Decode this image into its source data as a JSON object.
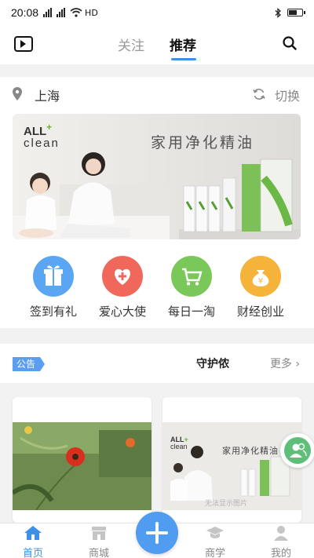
{
  "status_bar": {
    "time": "20:08",
    "network": "HD",
    "battery_level": 0.6
  },
  "top_nav": {
    "tabs": [
      {
        "label": "关注",
        "active": false
      },
      {
        "label": "推荐",
        "active": true
      }
    ]
  },
  "location": {
    "city": "上海",
    "switch_label": "切换"
  },
  "banner": {
    "title": "家用净化精油",
    "brand_line1": "ALL",
    "brand_line2": "clean"
  },
  "quick_actions": [
    {
      "label": "签到有礼",
      "icon": "gift-icon",
      "color": "#5aa6f2"
    },
    {
      "label": "爱心大使",
      "icon": "heart-plus-icon",
      "color": "#f0685c"
    },
    {
      "label": "每日一淘",
      "icon": "cart-icon",
      "color": "#7ac85a"
    },
    {
      "label": "财经创业",
      "icon": "money-bag-icon",
      "color": "#f5b33a"
    }
  ],
  "notice": {
    "badge": "公告",
    "text": "守护侬",
    "more_label": "更多"
  },
  "cards": [
    {
      "image": "red-flower-photo"
    },
    {
      "title": "家用净化精油",
      "brand_line1": "ALL",
      "brand_line2": "clean",
      "caption": "无法显示图片"
    }
  ],
  "tab_bar": {
    "items": [
      {
        "label": "首页",
        "active": true
      },
      {
        "label": "商城",
        "active": false
      },
      {
        "label": "商学",
        "active": false
      },
      {
        "label": "我的",
        "active": false
      }
    ]
  },
  "colors": {
    "accent": "#3d8fe8",
    "notice_badge": "#5b9ef0",
    "add_button": "#4f9cf0"
  }
}
